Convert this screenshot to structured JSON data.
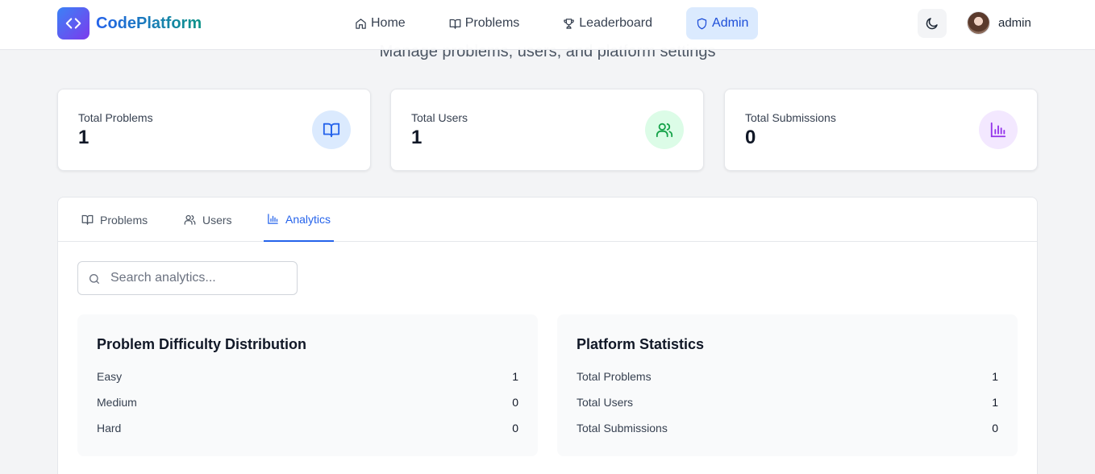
{
  "subtitle": "Manage problems, users, and platform settings",
  "header": {
    "brand": "CodePlatform",
    "nav": [
      {
        "label": "Home",
        "icon": "home-icon"
      },
      {
        "label": "Problems",
        "icon": "book-icon"
      },
      {
        "label": "Leaderboard",
        "icon": "trophy-icon"
      },
      {
        "label": "Admin",
        "icon": "shield-icon",
        "active": true
      }
    ],
    "username": "admin"
  },
  "stats": [
    {
      "label": "Total Problems",
      "value": "1",
      "icon": "book-icon",
      "color": "#2563eb",
      "bg": "#dbeafe"
    },
    {
      "label": "Total Users",
      "value": "1",
      "icon": "users-icon",
      "color": "#16a34a",
      "bg": "#dcfce7"
    },
    {
      "label": "Total Submissions",
      "value": "0",
      "icon": "bar-chart-icon",
      "color": "#9333ea",
      "bg": "#f3e8ff"
    }
  ],
  "tabs": [
    {
      "label": "Problems",
      "icon": "book-icon"
    },
    {
      "label": "Users",
      "icon": "users-icon"
    },
    {
      "label": "Analytics",
      "icon": "bar-chart-icon",
      "active": true
    }
  ],
  "search": {
    "placeholder": "Search analytics...",
    "value": ""
  },
  "difficulty": {
    "title": "Problem Difficulty Distribution",
    "rows": [
      {
        "label": "Easy",
        "value": "1"
      },
      {
        "label": "Medium",
        "value": "0"
      },
      {
        "label": "Hard",
        "value": "0"
      }
    ]
  },
  "platform": {
    "title": "Platform Statistics",
    "rows": [
      {
        "label": "Total Problems",
        "value": "1"
      },
      {
        "label": "Total Users",
        "value": "1"
      },
      {
        "label": "Total Submissions",
        "value": "0"
      }
    ]
  },
  "colors": {
    "accent": "#2563eb",
    "active_nav_bg": "#dbeafe"
  }
}
